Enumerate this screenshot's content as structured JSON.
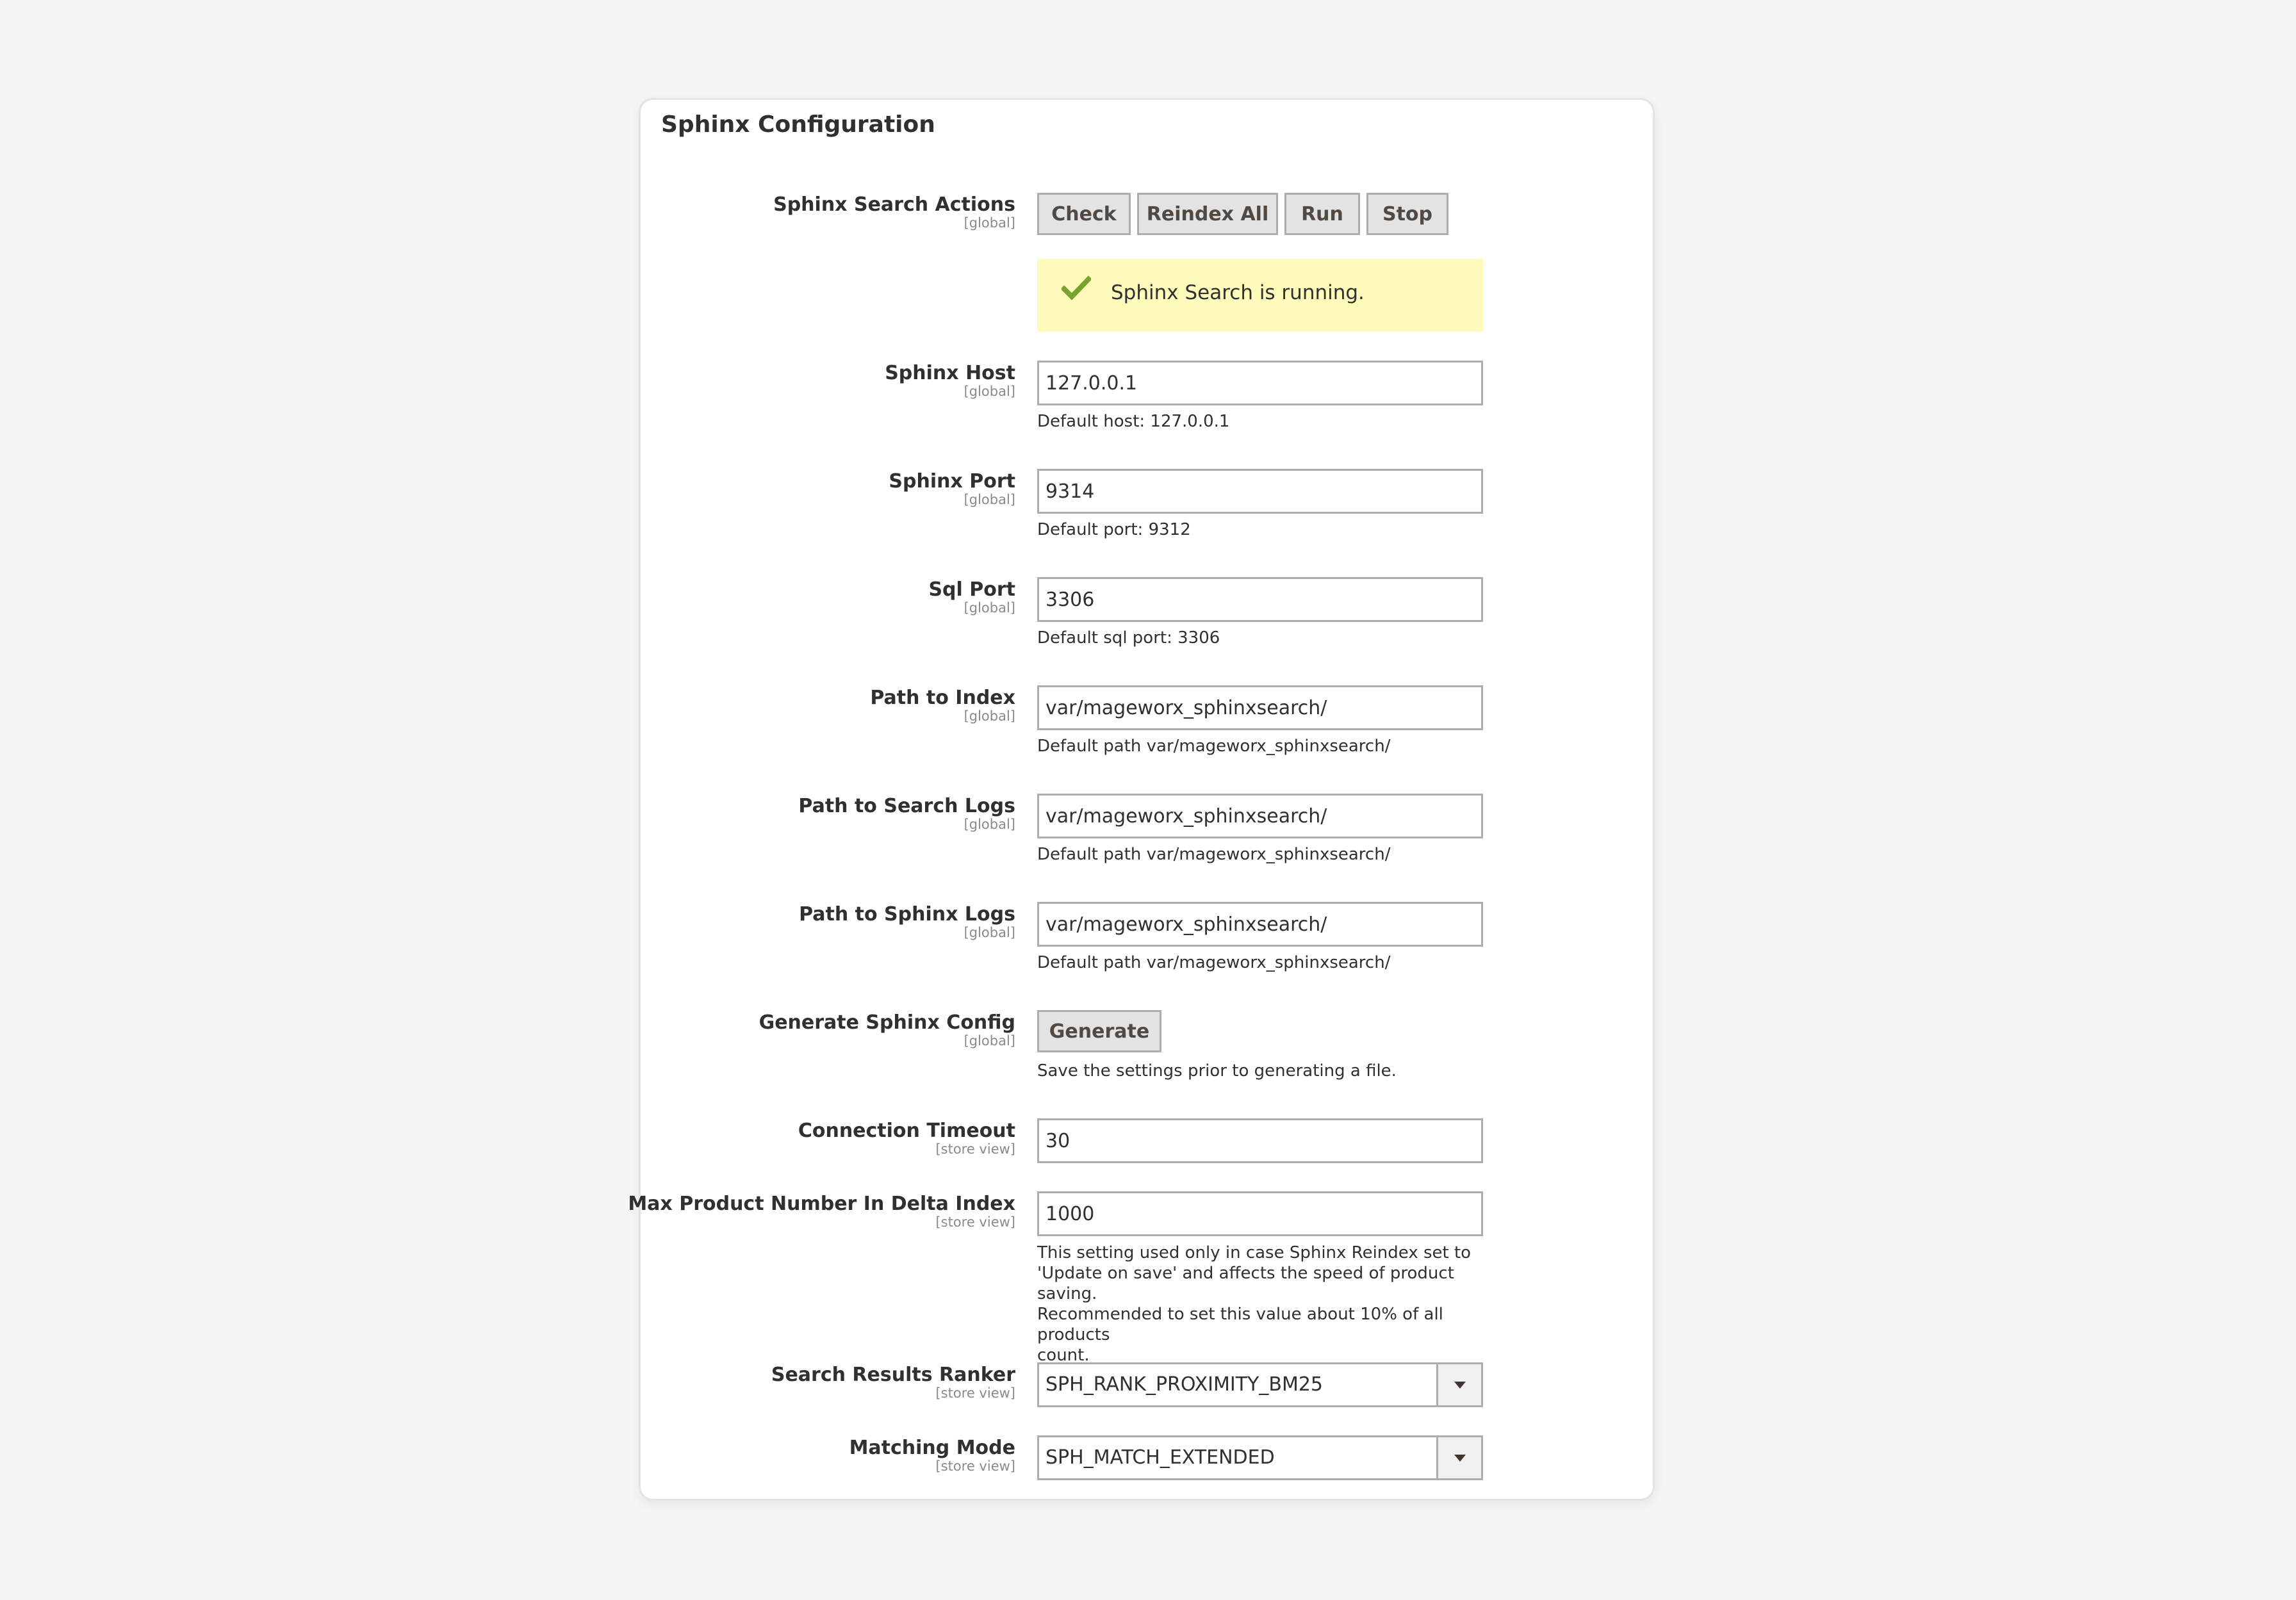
{
  "section": {
    "title": "Sphinx Configuration"
  },
  "colors": {
    "notice_bg": "#fffbbb",
    "check": "#79a22e",
    "button_bg": "#e3e3e3"
  },
  "actions": {
    "label": "Sphinx Search Actions",
    "scope": "[global]",
    "buttons": {
      "check": "Check",
      "reindex": "Reindex All",
      "run": "Run",
      "stop": "Stop"
    },
    "status_icon": "checkmark-icon",
    "status": "Sphinx Search is running."
  },
  "host": {
    "label": "Sphinx Host",
    "scope": "[global]",
    "value": "127.0.0.1",
    "note": "Default host: 127.0.0.1"
  },
  "port": {
    "label": "Sphinx Port",
    "scope": "[global]",
    "value": "9314",
    "note": "Default port: 9312"
  },
  "sql_port": {
    "label": "Sql Port",
    "scope": "[global]",
    "value": "3306",
    "note": "Default sql port: 3306"
  },
  "index_path": {
    "label": "Path to Index",
    "scope": "[global]",
    "value": "var/mageworx_sphinxsearch/",
    "note": "Default path var/mageworx_sphinxsearch/"
  },
  "search_logs": {
    "label": "Path to Search Logs",
    "scope": "[global]",
    "value": "var/mageworx_sphinxsearch/",
    "note": "Default path var/mageworx_sphinxsearch/"
  },
  "sphinx_logs": {
    "label": "Path to Sphinx Logs",
    "scope": "[global]",
    "value": "var/mageworx_sphinxsearch/",
    "note": "Default path var/mageworx_sphinxsearch/"
  },
  "generate": {
    "label": "Generate Sphinx Config",
    "scope": "[global]",
    "button": "Generate",
    "note": "Save the settings prior to generating a file."
  },
  "timeout": {
    "label": "Connection Timeout",
    "scope": "[store view]",
    "value": "30"
  },
  "delta": {
    "label": "Max Product Number In Delta Index",
    "scope": "[store view]",
    "value": "1000",
    "note_lines": [
      "This setting used only in case Sphinx Reindex set to",
      "'Update on save' and affects the speed of product saving.",
      "Recommended to set this value about 10% of all products",
      "count."
    ]
  },
  "ranker": {
    "label": "Search Results Ranker",
    "scope": "[store view]",
    "value": "SPH_RANK_PROXIMITY_BM25",
    "icon": "chevron-down-icon"
  },
  "matching": {
    "label": "Matching Mode",
    "scope": "[store view]",
    "value": "SPH_MATCH_EXTENDED",
    "icon": "chevron-down-icon"
  }
}
